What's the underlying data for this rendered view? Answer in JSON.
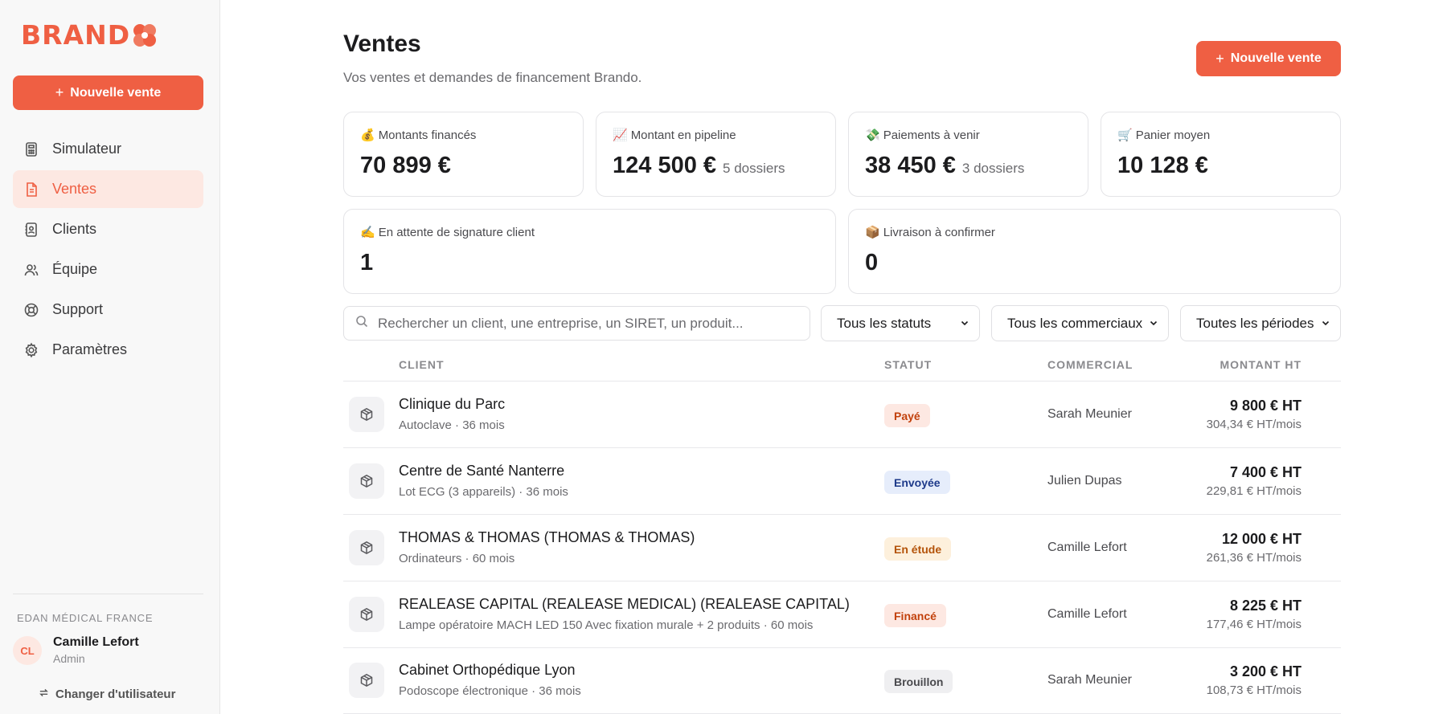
{
  "brand": {
    "name": "BRAND",
    "accent": "#ef5f43"
  },
  "sidebar": {
    "new_sale_label": "Nouvelle vente",
    "items": [
      {
        "label": "Simulateur",
        "icon": "calculator-icon"
      },
      {
        "label": "Ventes",
        "icon": "document-icon",
        "active": true
      },
      {
        "label": "Clients",
        "icon": "contacts-icon"
      },
      {
        "label": "Équipe",
        "icon": "users-icon"
      },
      {
        "label": "Support",
        "icon": "lifebuoy-icon"
      },
      {
        "label": "Paramètres",
        "icon": "gear-icon"
      }
    ],
    "organization": "EDAN MÉDICAL FRANCE",
    "user": {
      "initials": "CL",
      "name": "Camille Lefort",
      "role": "Admin"
    },
    "switch_user_label": "Changer d'utilisateur"
  },
  "header": {
    "title": "Ventes",
    "subtitle": "Vos ventes et demandes de financement Brando.",
    "new_sale_label": "Nouvelle vente"
  },
  "stats": [
    {
      "emoji": "💰",
      "label": "Montants financés",
      "value": "70 899 €",
      "suffix": ""
    },
    {
      "emoji": "📈",
      "label": "Montant en pipeline",
      "value": "124 500 €",
      "suffix": "5 dossiers"
    },
    {
      "emoji": "💸",
      "label": "Paiements à venir",
      "value": "38 450 €",
      "suffix": "3 dossiers"
    },
    {
      "emoji": "🛒",
      "label": "Panier moyen",
      "value": "10 128 €",
      "suffix": ""
    },
    {
      "emoji": "✍️",
      "label": "En attente de signature client",
      "value": "1",
      "suffix": ""
    },
    {
      "emoji": "📦",
      "label": "Livraison à confirmer",
      "value": "0",
      "suffix": ""
    }
  ],
  "filters": {
    "search_placeholder": "Rechercher un client, une entreprise, un SIRET, un produit...",
    "search_value": "",
    "status": "Tous les statuts",
    "commercial": "Tous les commerciaux",
    "period": "Toutes les périodes"
  },
  "table": {
    "headers": {
      "client": "CLIENT",
      "status": "STATUT",
      "commercial": "COMMERCIAL",
      "amount": "MONTANT HT"
    },
    "rows": [
      {
        "client": "Clinique du Parc",
        "detail": "Autoclave · 36 mois",
        "status": "Payé",
        "status_color": "#c2410c",
        "status_bg": "#fde8e2",
        "commercial": "Sarah Meunier",
        "amount": "9 800 € HT",
        "monthly": "304,34 € HT/mois"
      },
      {
        "client": "Centre de Santé Nanterre",
        "detail": "Lot ECG (3 appareils) · 36 mois",
        "status": "Envoyée",
        "status_color": "#1e3a8a",
        "status_bg": "#e6edfb",
        "commercial": "Julien Dupas",
        "amount": "7 400 € HT",
        "monthly": "229,81 € HT/mois"
      },
      {
        "client": "THOMAS & THOMAS (THOMAS & THOMAS)",
        "detail": "Ordinateurs · 60 mois",
        "status": "En étude",
        "status_color": "#b45309",
        "status_bg": "#fdf0dc",
        "commercial": "Camille Lefort",
        "amount": "12 000 € HT",
        "monthly": "261,36 € HT/mois"
      },
      {
        "client": "REALEASE CAPITAL (REALEASE MEDICAL) (REALEASE CAPITAL)",
        "detail": "Lampe opératoire MACH LED 150 Avec fixation murale + 2 produits · 60 mois",
        "status": "Financé",
        "status_color": "#c2410c",
        "status_bg": "#fde8e2",
        "commercial": "Camille Lefort",
        "amount": "8 225 € HT",
        "monthly": "177,46 € HT/mois"
      },
      {
        "client": "Cabinet Orthopédique Lyon",
        "detail": "Podoscope électronique · 36 mois",
        "status": "Brouillon",
        "status_color": "#4a4a4e",
        "status_bg": "#efeff1",
        "commercial": "Sarah Meunier",
        "amount": "3 200 € HT",
        "monthly": "108,73 € HT/mois"
      }
    ]
  }
}
